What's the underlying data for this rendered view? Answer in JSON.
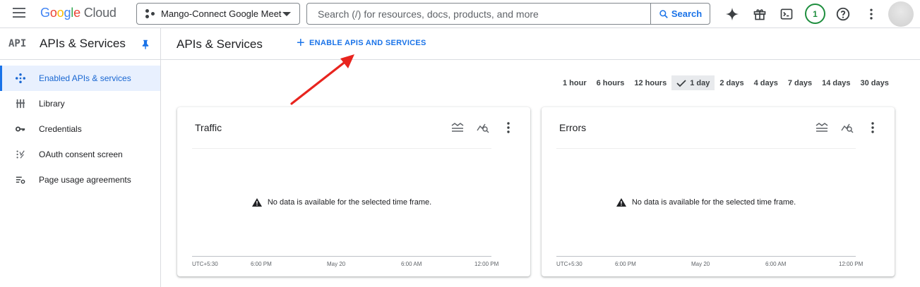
{
  "header": {
    "logo_parts": [
      "G",
      "o",
      "o",
      "g",
      "l",
      "e"
    ],
    "logo_suffix": "Cloud",
    "project_name": "Mango-Connect Google Meet",
    "search_placeholder": "Search (/) for resources, docs, products, and more",
    "search_button": "Search",
    "notification_count": "1"
  },
  "sidebar": {
    "badge": "API",
    "title": "APIs & Services",
    "items": [
      {
        "label": "Enabled APIs & services",
        "icon": "diamond-dots-icon"
      },
      {
        "label": "Library",
        "icon": "library-icon"
      },
      {
        "label": "Credentials",
        "icon": "key-icon"
      },
      {
        "label": "OAuth consent screen",
        "icon": "oauth-icon"
      },
      {
        "label": "Page usage agreements",
        "icon": "settings-list-icon"
      }
    ]
  },
  "main": {
    "title": "APIs & Services",
    "enable_button": "ENABLE APIS AND SERVICES"
  },
  "time_range": {
    "options": [
      "1 hour",
      "6 hours",
      "12 hours",
      "1 day",
      "2 days",
      "4 days",
      "7 days",
      "14 days",
      "30 days"
    ],
    "selected": "1 day"
  },
  "cards": [
    {
      "title": "Traffic",
      "message": "No data is available for the selected time frame.",
      "ticks": [
        "UTC+5:30",
        "6:00 PM",
        "May 20",
        "6:00 AM",
        "12:00 PM"
      ]
    },
    {
      "title": "Errors",
      "message": "No data is available for the selected time frame.",
      "ticks": [
        "UTC+5:30",
        "6:00 PM",
        "May 20",
        "6:00 AM",
        "12:00 PM"
      ]
    }
  ],
  "colors": {
    "accent": "#1a73e8",
    "annotation_arrow": "#e8241e",
    "selected_bg": "#e8f0fe"
  }
}
